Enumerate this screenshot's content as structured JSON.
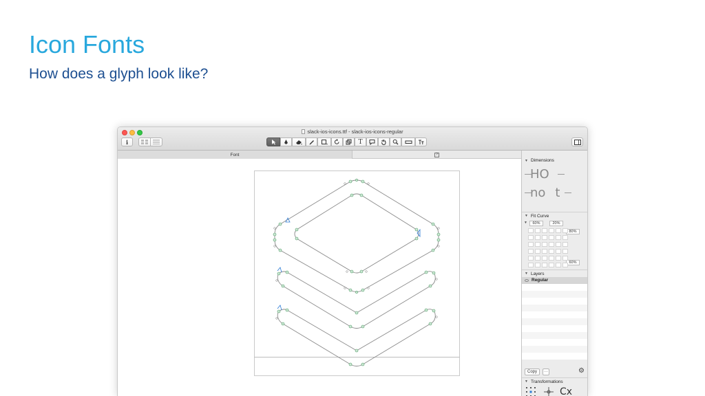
{
  "slide": {
    "title": "Icon Fonts",
    "subtitle": "How does a glyph look like?",
    "title_color": "#29a8dd",
    "subtitle_color": "#1d4f91"
  },
  "window": {
    "title": "slack-ios-icons.ttf - slack-ios-icons-regular",
    "traffic_lights": [
      "close",
      "minimize",
      "maximize"
    ]
  },
  "toolbar": {
    "info_icon": "info-icon",
    "view_modes": [
      "grid-view-icon",
      "list-view-icon"
    ],
    "tools": [
      "select-tool-icon",
      "pen-tool-icon",
      "eraser-tool-icon",
      "pencil-tool-icon",
      "rectangle-tool-icon",
      "rotate-tool-icon",
      "scale-tool-icon",
      "text-tool-icon",
      "annotation-tool-icon",
      "hand-tool-icon",
      "zoom-tool-icon",
      "measure-tool-icon",
      "typeset-tool-icon"
    ],
    "selected_tool": "select-tool-icon",
    "sidebar_toggle": "sidebar-toggle-icon"
  },
  "tabs": {
    "font_tab": "Font",
    "glyph_tab_icon": "?"
  },
  "inspector": {
    "dimensions": {
      "label": "Dimensions",
      "preview_upper": "HO",
      "preview_lower": "no",
      "preview_t": "t"
    },
    "fit_curve": {
      "label": "Fit Curve",
      "value_1": "60%",
      "value_2": "20%",
      "value_top_right": "80%",
      "value_bottom_right": "60%"
    },
    "layers": {
      "label": "Layers",
      "items": [
        {
          "name": "Regular"
        }
      ],
      "copy_label": "Copy",
      "more_label": "···"
    },
    "transformations": {
      "label": "Transformations",
      "preview": "Cx"
    }
  }
}
